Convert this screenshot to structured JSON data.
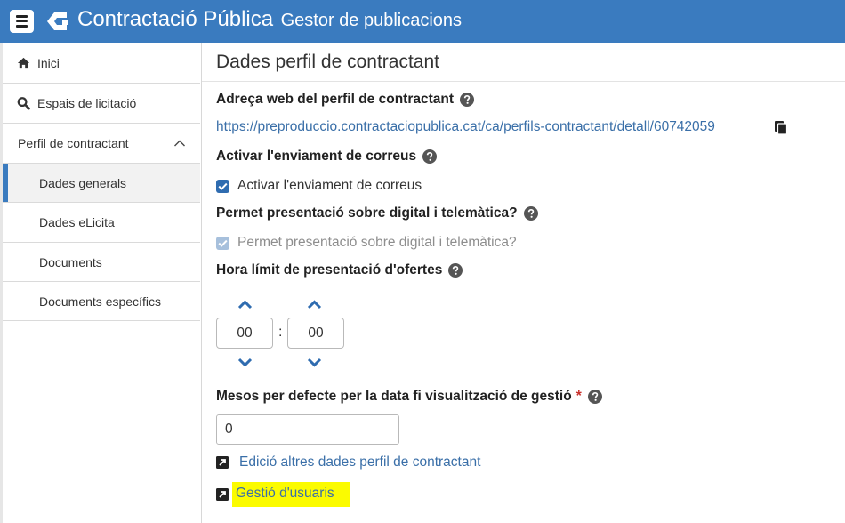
{
  "header": {
    "title": "Contractació Pública",
    "subtitle": "Gestor de publicacions",
    "colors": {
      "bar": "#3a7bbf"
    }
  },
  "sidebar": {
    "items": [
      {
        "label": "Inici",
        "icon": "home-icon"
      },
      {
        "label": "Espais de licitació",
        "icon": "search-icon"
      },
      {
        "label": "Perfil de contractant",
        "icon": "chevron-up-icon",
        "expanded": true
      },
      {
        "label": "Dades generals",
        "active": true
      },
      {
        "label": "Dades eLicita"
      },
      {
        "label": "Documents"
      },
      {
        "label": "Documents específics"
      }
    ]
  },
  "main": {
    "title": "Dades perfil de contractant",
    "profile_url_label": "Adreça web del perfil de contractant",
    "profile_url": "https://preproduccio.contractaciopublica.cat/ca/perfils-contractant/detall/60742059",
    "mail_label": "Activar l'enviament de correus",
    "mail_checkbox": {
      "label": "Activar l'enviament de correus",
      "checked": true
    },
    "digital_label": "Permet presentació sobre digital i telemàtica?",
    "digital_checkbox": {
      "label": "Permet presentació sobre digital i telemàtica?",
      "checked": true,
      "disabled": true
    },
    "deadline_label": "Hora límit de presentació d'ofertes",
    "deadline": {
      "hours": "00",
      "separator": ":",
      "minutes": "00"
    },
    "months_label": "Mesos per defecte per la data fi visualització de gestió",
    "months_required_mark": "*",
    "months_value": "0",
    "links": {
      "edit_other": "Edició altres dades perfil de contractant",
      "user_mgmt": "Gestió d'usuaris"
    },
    "colors": {
      "link": "#3a6fa8",
      "highlight": "#fbfb00",
      "checkbox": "#2f6cb0"
    }
  }
}
